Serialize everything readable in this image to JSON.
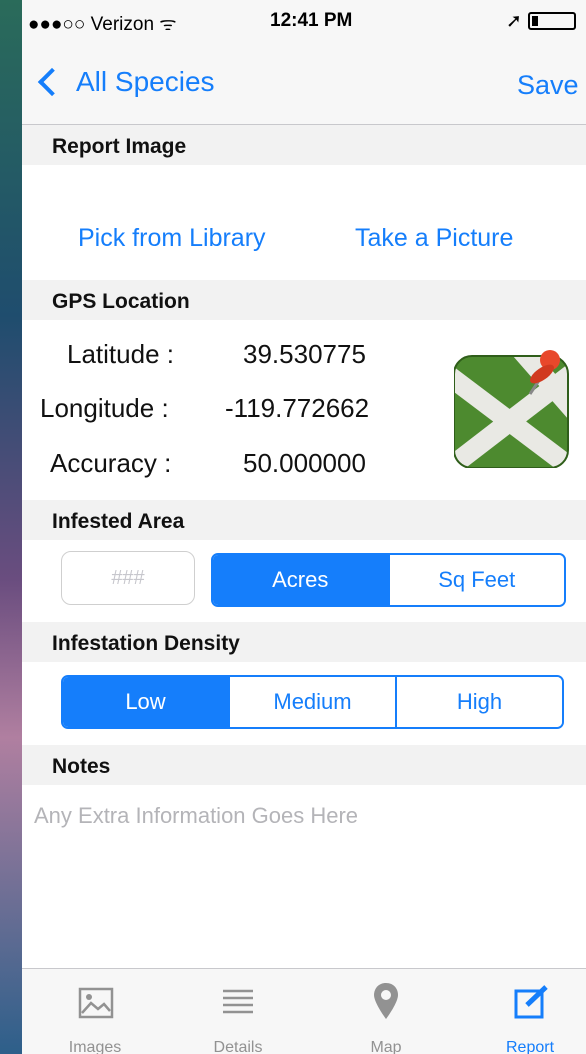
{
  "status": {
    "carrier": "●●●○○ Verizon ᯤ",
    "time": "12:41 PM",
    "location_arrow": "➚"
  },
  "nav": {
    "back_label": "All Species",
    "save_label": "Save"
  },
  "sections": {
    "report_image": "Report Image",
    "gps_location": "GPS Location",
    "infested_area": "Infested Area",
    "infestation_density": "Infestation Density",
    "notes": "Notes"
  },
  "image_actions": {
    "pick": "Pick from Library",
    "take": "Take a Picture"
  },
  "gps": {
    "latitude_label": "Latitude :",
    "latitude": "39.530775",
    "longitude_label": "Longitude :",
    "longitude": "-119.772662",
    "accuracy_label": "Accuracy :",
    "accuracy": "50.000000"
  },
  "area": {
    "placeholder": "###",
    "units": [
      "Acres",
      "Sq Feet"
    ],
    "selected": "Acres"
  },
  "density": {
    "options": [
      "Low",
      "Medium",
      "High"
    ],
    "selected": "Low"
  },
  "notes": {
    "placeholder": "Any Extra Information Goes Here"
  },
  "tabs": [
    {
      "label": "Images",
      "icon": "image-icon"
    },
    {
      "label": "Details",
      "icon": "list-icon"
    },
    {
      "label": "Map",
      "icon": "map-pin-icon"
    },
    {
      "label": "Report",
      "icon": "edit-icon",
      "active": true
    }
  ],
  "colors": {
    "accent": "#157efb",
    "section_bg": "#f2f2f2",
    "map_green": "#4d8a2f",
    "pin_red": "#e8482b"
  }
}
